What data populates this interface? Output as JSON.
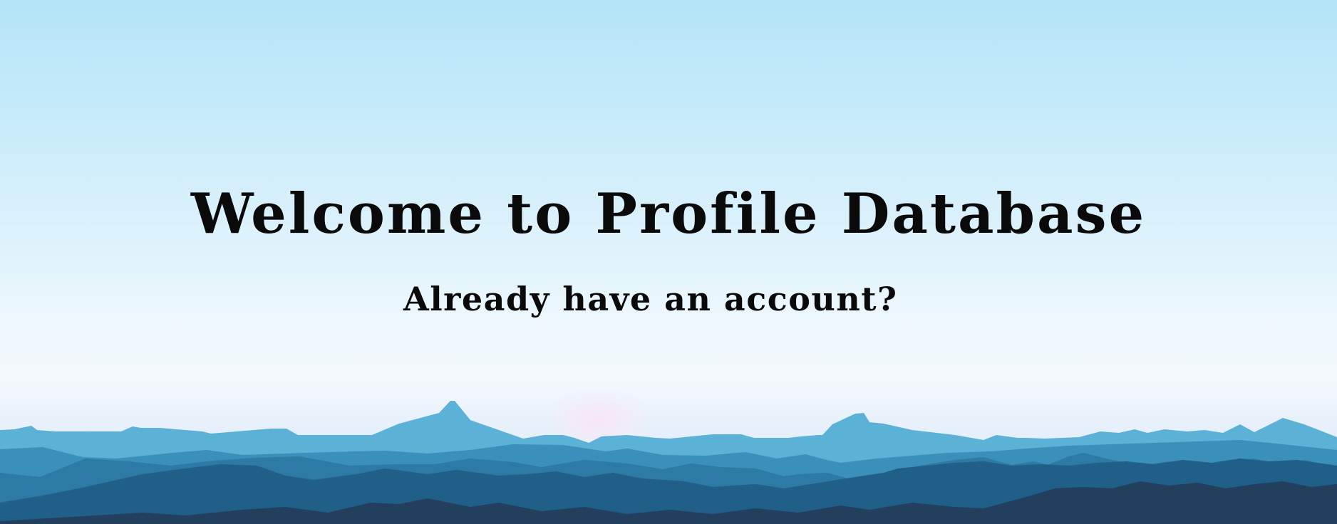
{
  "hero": {
    "title": "Welcome to Profile Database",
    "subtitle": "Already have an account?"
  },
  "colors": {
    "sky_top": "#b4e4f8",
    "sky_mid": "#eef8fd",
    "mountain_light": "#4aa3c8",
    "mountain_mid": "#2f7fa8",
    "mountain_dark": "#1f5a80",
    "mountain_darkest": "#253b57",
    "text": "#0a0a0a"
  },
  "background": {
    "image": "mountain-landscape-illustration"
  }
}
